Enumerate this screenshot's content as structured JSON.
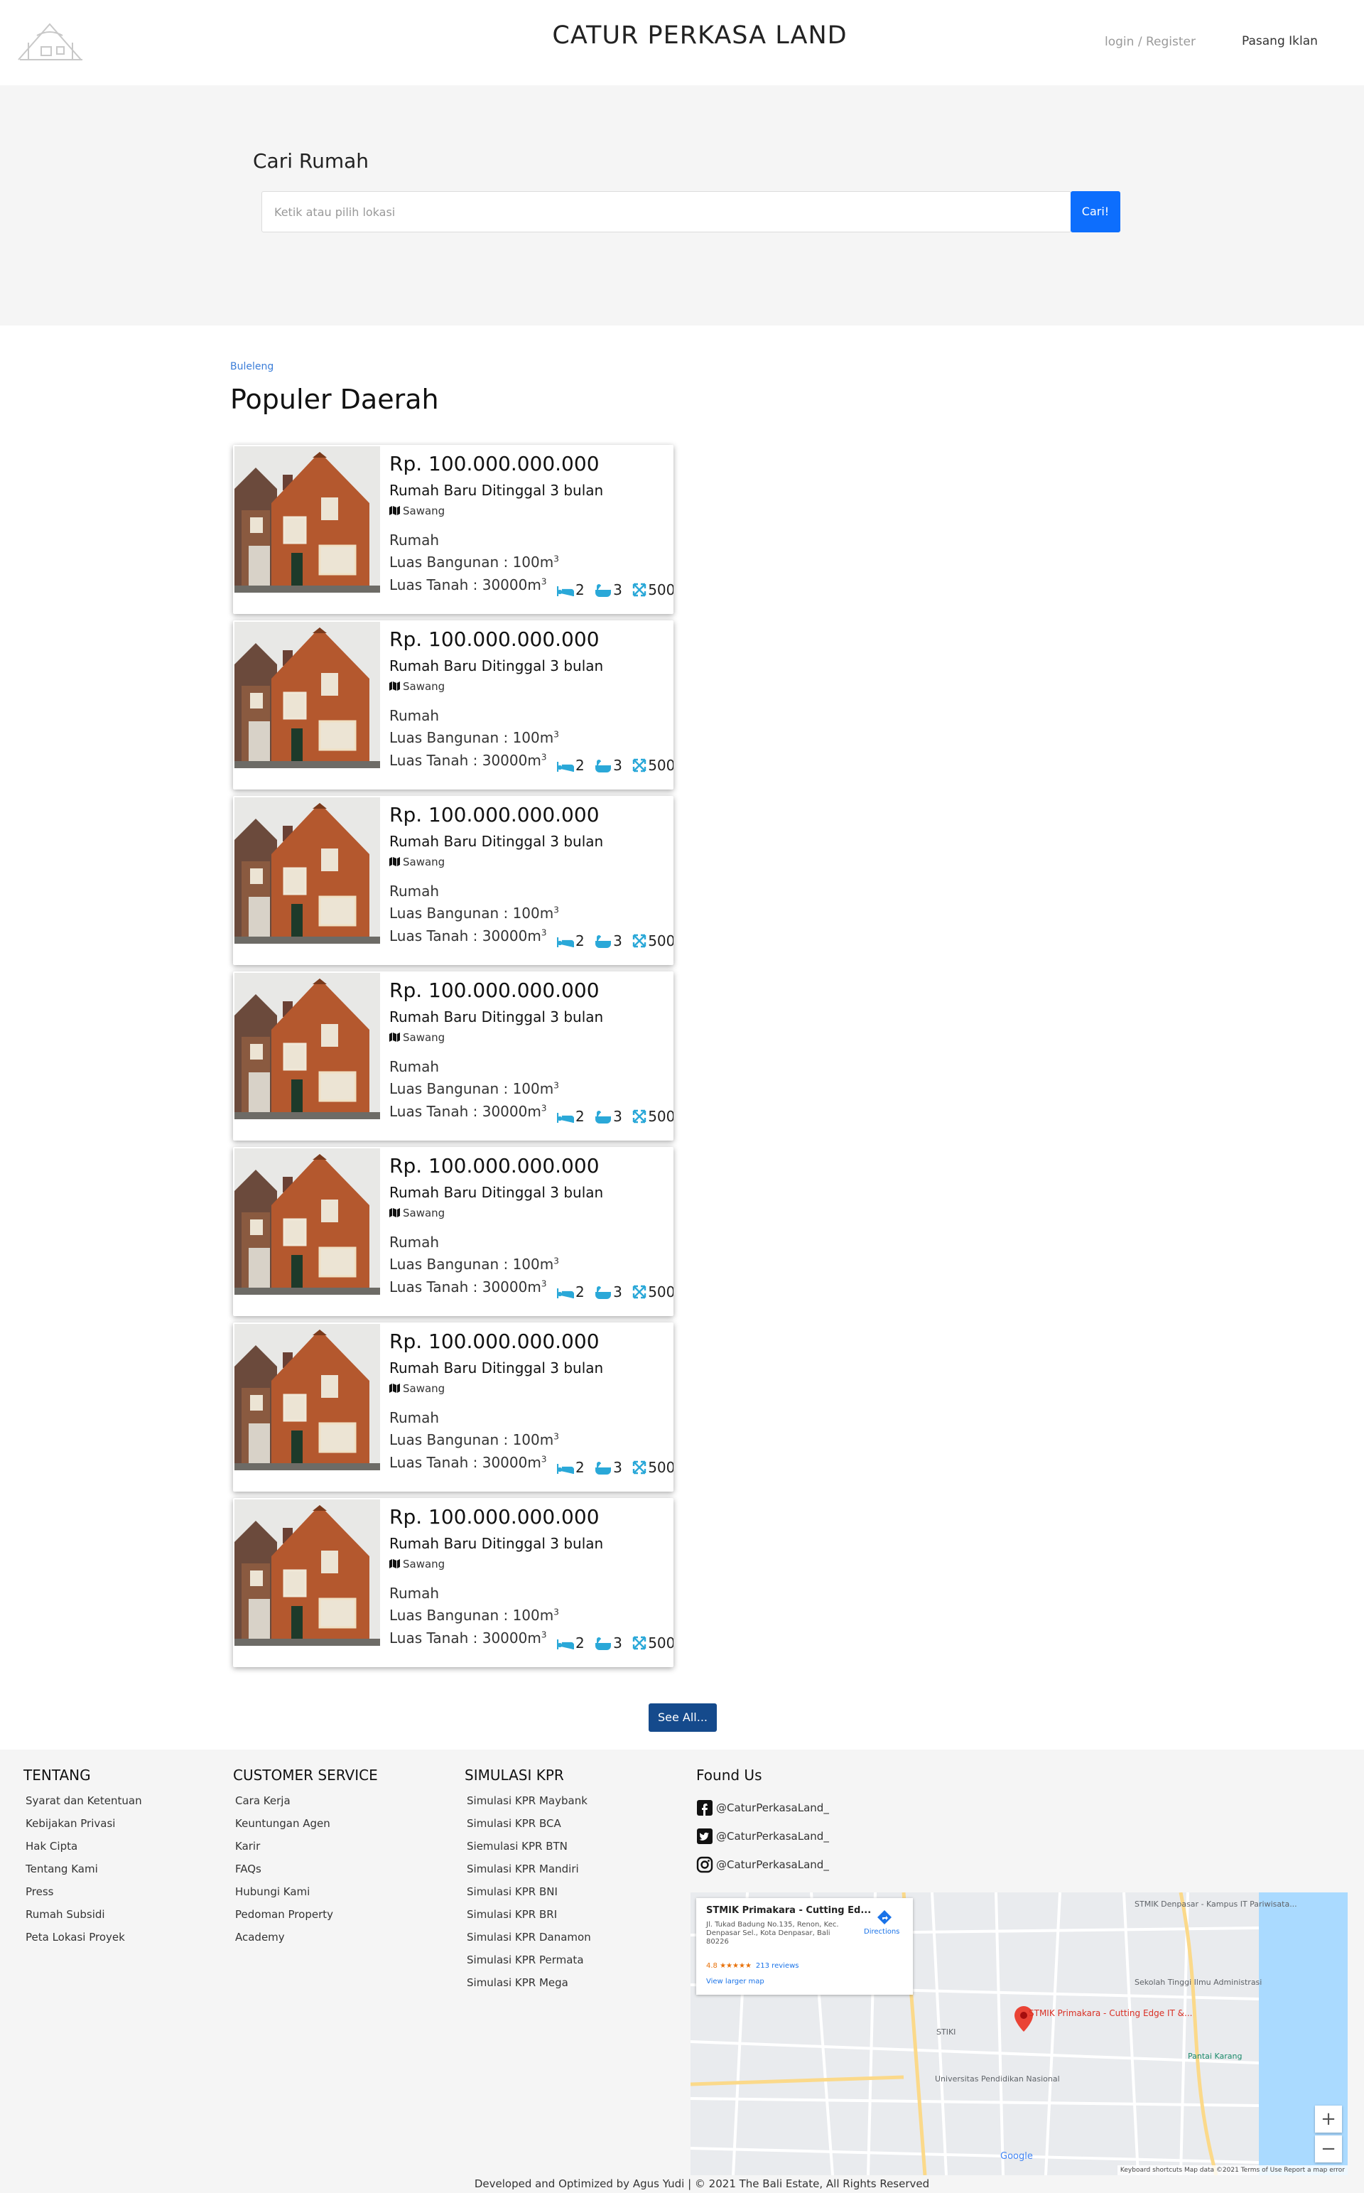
{
  "header": {
    "brand": "CATUR PERKASA LAND",
    "login": "login / Register",
    "pasang_iklan": "Pasang Iklan"
  },
  "search": {
    "title": "Cari Rumah",
    "placeholder": "Ketik atau pilih lokasi",
    "button": "Cari!"
  },
  "main": {
    "breadcrumb": "Buleleng",
    "section_title": "Populer Daerah",
    "see_all": "See All..."
  },
  "listings": [
    {
      "price": "Rp. 100.000.000.000",
      "title": "Rumah Baru Ditinggal 3 bulan",
      "location": "Sawang",
      "type": "Rumah",
      "luas_bangunan": "Luas Bangunan : 100m",
      "luas_tanah": "Luas Tanah : 30000m",
      "sup": "3",
      "beds": "2",
      "baths": "3",
      "area": "500"
    },
    {
      "price": "Rp. 100.000.000.000",
      "title": "Rumah Baru Ditinggal 3 bulan",
      "location": "Sawang",
      "type": "Rumah",
      "luas_bangunan": "Luas Bangunan : 100m",
      "luas_tanah": "Luas Tanah : 30000m",
      "sup": "3",
      "beds": "2",
      "baths": "3",
      "area": "500"
    },
    {
      "price": "Rp. 100.000.000.000",
      "title": "Rumah Baru Ditinggal 3 bulan",
      "location": "Sawang",
      "type": "Rumah",
      "luas_bangunan": "Luas Bangunan : 100m",
      "luas_tanah": "Luas Tanah : 30000m",
      "sup": "3",
      "beds": "2",
      "baths": "3",
      "area": "500"
    },
    {
      "price": "Rp. 100.000.000.000",
      "title": "Rumah Baru Ditinggal 3 bulan",
      "location": "Sawang",
      "type": "Rumah",
      "luas_bangunan": "Luas Bangunan : 100m",
      "luas_tanah": "Luas Tanah : 30000m",
      "sup": "3",
      "beds": "2",
      "baths": "3",
      "area": "500"
    },
    {
      "price": "Rp. 100.000.000.000",
      "title": "Rumah Baru Ditinggal 3 bulan",
      "location": "Sawang",
      "type": "Rumah",
      "luas_bangunan": "Luas Bangunan : 100m",
      "luas_tanah": "Luas Tanah : 30000m",
      "sup": "3",
      "beds": "2",
      "baths": "3",
      "area": "500"
    },
    {
      "price": "Rp. 100.000.000.000",
      "title": "Rumah Baru Ditinggal 3 bulan",
      "location": "Sawang",
      "type": "Rumah",
      "luas_bangunan": "Luas Bangunan : 100m",
      "luas_tanah": "Luas Tanah : 30000m",
      "sup": "3",
      "beds": "2",
      "baths": "3",
      "area": "500"
    },
    {
      "price": "Rp. 100.000.000.000",
      "title": "Rumah Baru Ditinggal 3 bulan",
      "location": "Sawang",
      "type": "Rumah",
      "luas_bangunan": "Luas Bangunan : 100m",
      "luas_tanah": "Luas Tanah : 30000m",
      "sup": "3",
      "beds": "2",
      "baths": "3",
      "area": "500"
    }
  ],
  "footer": {
    "tentang": {
      "heading": "TENTANG",
      "links": [
        "Syarat dan Ketentuan",
        "Kebijakan Privasi",
        "Hak Cipta",
        "Tentang Kami",
        "Press",
        "Rumah Subsidi",
        "Peta Lokasi Proyek"
      ]
    },
    "customer_service": {
      "heading": "CUSTOMER SERVICE",
      "links": [
        "Cara Kerja",
        "Keuntungan Agen",
        "Karir",
        "FAQs",
        "Hubungi Kami",
        "Pedoman Property",
        "Academy"
      ]
    },
    "simulasi_kpr": {
      "heading": "SIMULASI KPR",
      "links": [
        "Simulasi KPR Maybank",
        "Simulasi KPR BCA",
        "Siemulasi KPR BTN",
        "Simulasi KPR Mandiri",
        "Simulasi KPR BNI",
        "Simulasi KPR BRI",
        "Simulasi KPR Danamon",
        "Simulasi KPR Permata",
        "Simulasi KPR Mega"
      ]
    },
    "found_us": {
      "heading": "Found Us",
      "accounts": [
        {
          "icon": "facebook-icon",
          "handle": "@CaturPerkasaLand_"
        },
        {
          "icon": "twitter-icon",
          "handle": "@CaturPerkasaLand_"
        },
        {
          "icon": "instagram-icon",
          "handle": "@CaturPerkasaLand_"
        }
      ]
    },
    "copyright": "Developed and Optimized by Agus Yudi | © 2021 The Bali Estate, All Rights Reserved"
  },
  "map": {
    "place_name": "STMIK Primakara - Cutting Ed...",
    "address": "Jl. Tukad Badung No.135, Renon, Kec. Denpasar Sel., Kota Denpasar, Bali 80226",
    "rating": "4.8 ★★★★★",
    "reviews": "213 reviews",
    "view_larger": "View larger map",
    "directions": "Directions",
    "pin_label": "STMIK Primakara - Cutting Edge IT &...",
    "labels": {
      "stmik_denpasar": "STMIK Denpasar - Kampus IT Pariwisata...",
      "sekolah": "Sekolah Tinggi Ilmu Administrasi",
      "stiki": "STIKI",
      "undiknas": "Universitas Pendidikan Nasional",
      "pantai": "Pantai Karang",
      "google": "Google"
    },
    "zoom_in": "+",
    "zoom_out": "−",
    "attribution": "Keyboard shortcuts   Map data ©2021   Terms of Use   Report a map error"
  }
}
